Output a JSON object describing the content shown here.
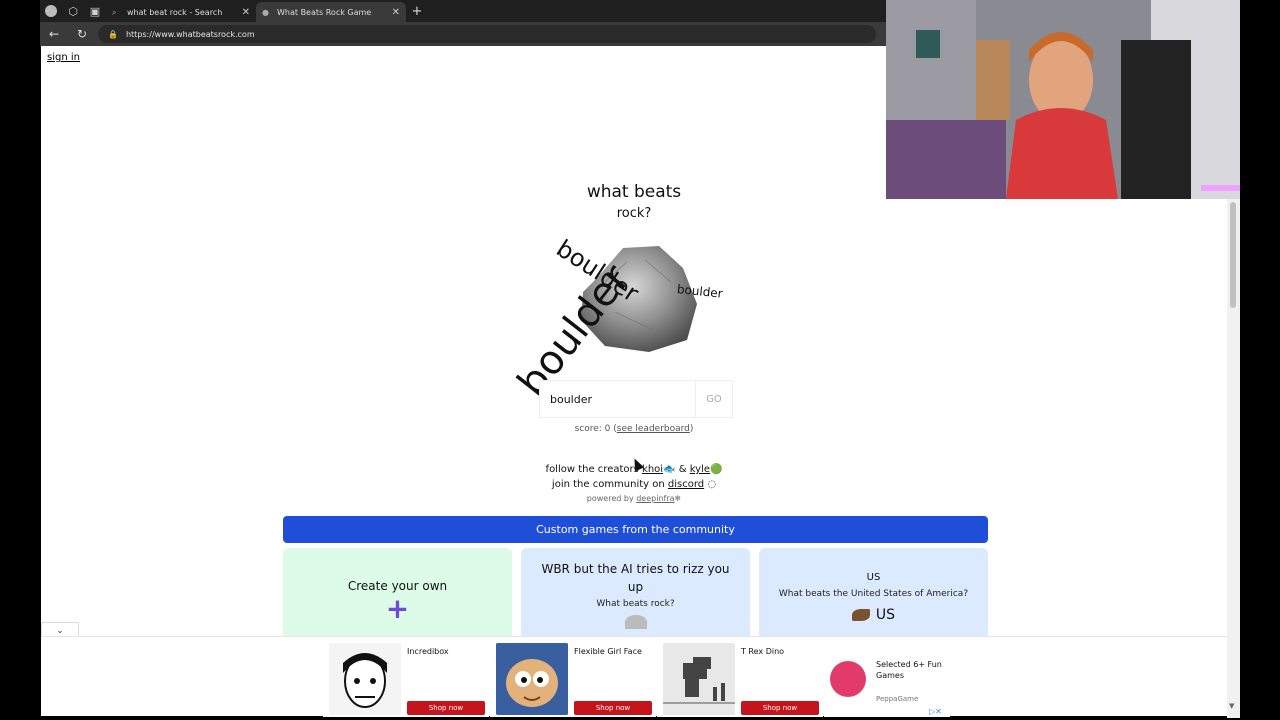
{
  "browser": {
    "tabs": [
      {
        "label": "what beat rock - Search",
        "active": false
      },
      {
        "label": "What Beats Rock Game",
        "active": true
      }
    ],
    "url": "https://www.whatbeatsrock.com"
  },
  "page": {
    "sign_in": "sign in",
    "title": "what beats",
    "subtitle": "rock?",
    "floating_words": [
      "boulder",
      "boulder",
      "boulder"
    ],
    "guess_value": "boulder",
    "go_label": "GO",
    "score_prefix": "score: 0 (",
    "leaderboard_link": "see leaderboard",
    "score_suffix": ")",
    "follow_text": "follow the creators",
    "creator1": "khoi",
    "amp": "&",
    "creator2": "kyle",
    "community_text": "join the community on",
    "discord": "discord",
    "powered_text": "powered by",
    "powered_link": "deepinfra",
    "custom_bar": "Custom games from the community",
    "cards": [
      {
        "title": "Create your own",
        "icon": "plus-icon"
      },
      {
        "title": "WBR but the AI tries to rizz you up",
        "sub": "What beats rock?"
      },
      {
        "title": "US",
        "sub": "What beats the United States of America?",
        "value": "US"
      }
    ]
  },
  "ads": [
    {
      "title": "Incredibox",
      "cta": "Shop now"
    },
    {
      "title": "Flexible Girl Face",
      "cta": "Shop now"
    },
    {
      "title": "T Rex Dino",
      "cta": "Shop now"
    },
    {
      "title": "Selected 6+ Fun Games",
      "brand": "PeppaGame"
    }
  ],
  "colors": {
    "accent_blue": "#1f4fd8",
    "card_green": "#dcfce7",
    "card_blue": "#dbeafe",
    "shop_red": "#c4141c",
    "plus_purple": "#6d4bd8"
  }
}
